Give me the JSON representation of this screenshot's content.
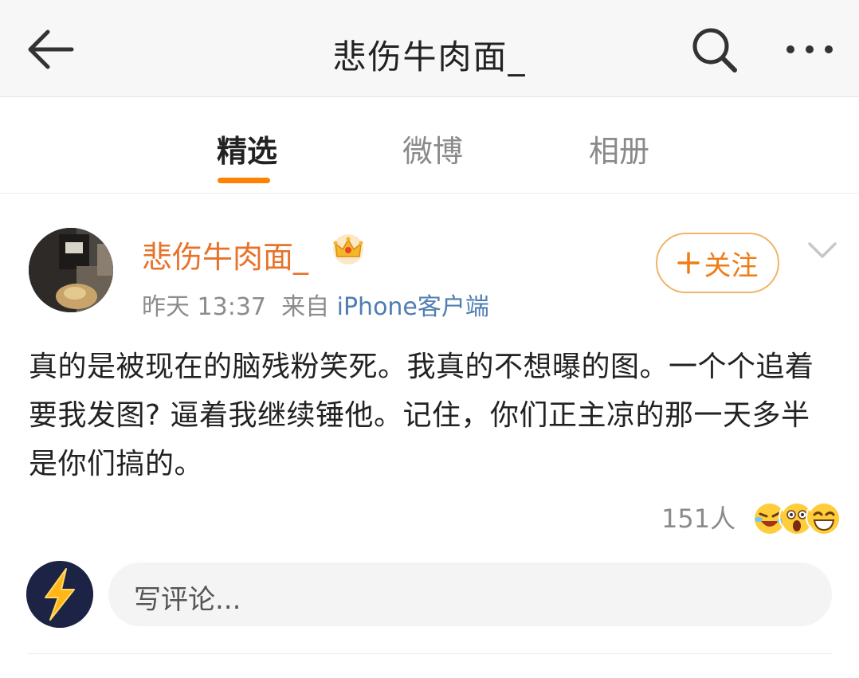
{
  "header": {
    "title": "悲伤牛肉面_",
    "back_icon": "arrow-left-icon",
    "search_icon": "search-icon",
    "more_icon": "more-horizontal-icon"
  },
  "tabs": [
    {
      "label": "精选",
      "active": true
    },
    {
      "label": "微博",
      "active": false
    },
    {
      "label": "相册",
      "active": false
    }
  ],
  "post": {
    "author": "悲伤牛肉面_",
    "badge_icon": "crown-icon",
    "time": "昨天 13:37",
    "source_prefix": "来自",
    "source": "iPhone客户端",
    "follow_label": "关注",
    "follow_icon": "plus-icon",
    "menu_icon": "chevron-down-icon",
    "text": "真的是被现在的脑残粉笑死。我真的不想曝的图。一个个追着要我发图? 逼着我继续锤他。记住，你们正主凉的那一天多半是你们搞的。",
    "reaction_count": "151人"
  },
  "comment": {
    "placeholder": "写评论...",
    "user_avatar_icon": "lightning-icon"
  },
  "colors": {
    "accent": "#ff8200",
    "username": "#e8722a",
    "source_link": "#4f7db2",
    "follow_border": "#f0b36a"
  }
}
